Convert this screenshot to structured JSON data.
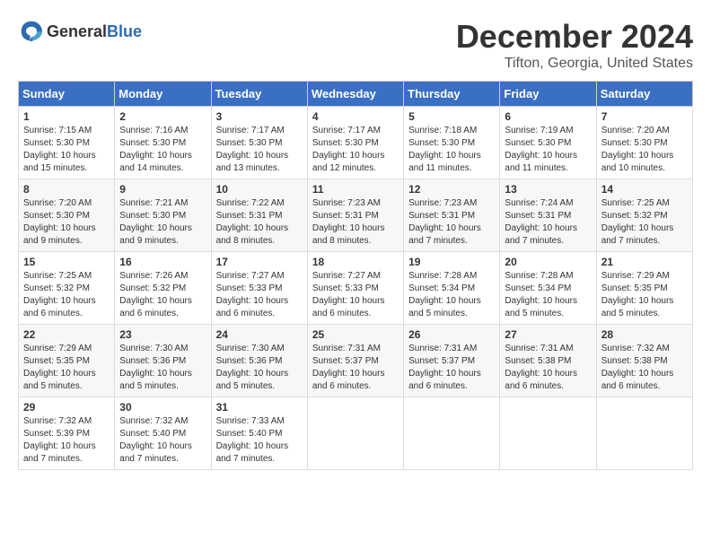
{
  "header": {
    "logo_general": "General",
    "logo_blue": "Blue",
    "month_year": "December 2024",
    "location": "Tifton, Georgia, United States"
  },
  "days_of_week": [
    "Sunday",
    "Monday",
    "Tuesday",
    "Wednesday",
    "Thursday",
    "Friday",
    "Saturday"
  ],
  "weeks": [
    [
      {
        "day": "1",
        "sunrise": "Sunrise: 7:15 AM",
        "sunset": "Sunset: 5:30 PM",
        "daylight": "Daylight: 10 hours and 15 minutes."
      },
      {
        "day": "2",
        "sunrise": "Sunrise: 7:16 AM",
        "sunset": "Sunset: 5:30 PM",
        "daylight": "Daylight: 10 hours and 14 minutes."
      },
      {
        "day": "3",
        "sunrise": "Sunrise: 7:17 AM",
        "sunset": "Sunset: 5:30 PM",
        "daylight": "Daylight: 10 hours and 13 minutes."
      },
      {
        "day": "4",
        "sunrise": "Sunrise: 7:17 AM",
        "sunset": "Sunset: 5:30 PM",
        "daylight": "Daylight: 10 hours and 12 minutes."
      },
      {
        "day": "5",
        "sunrise": "Sunrise: 7:18 AM",
        "sunset": "Sunset: 5:30 PM",
        "daylight": "Daylight: 10 hours and 11 minutes."
      },
      {
        "day": "6",
        "sunrise": "Sunrise: 7:19 AM",
        "sunset": "Sunset: 5:30 PM",
        "daylight": "Daylight: 10 hours and 11 minutes."
      },
      {
        "day": "7",
        "sunrise": "Sunrise: 7:20 AM",
        "sunset": "Sunset: 5:30 PM",
        "daylight": "Daylight: 10 hours and 10 minutes."
      }
    ],
    [
      {
        "day": "8",
        "sunrise": "Sunrise: 7:20 AM",
        "sunset": "Sunset: 5:30 PM",
        "daylight": "Daylight: 10 hours and 9 minutes."
      },
      {
        "day": "9",
        "sunrise": "Sunrise: 7:21 AM",
        "sunset": "Sunset: 5:30 PM",
        "daylight": "Daylight: 10 hours and 9 minutes."
      },
      {
        "day": "10",
        "sunrise": "Sunrise: 7:22 AM",
        "sunset": "Sunset: 5:31 PM",
        "daylight": "Daylight: 10 hours and 8 minutes."
      },
      {
        "day": "11",
        "sunrise": "Sunrise: 7:23 AM",
        "sunset": "Sunset: 5:31 PM",
        "daylight": "Daylight: 10 hours and 8 minutes."
      },
      {
        "day": "12",
        "sunrise": "Sunrise: 7:23 AM",
        "sunset": "Sunset: 5:31 PM",
        "daylight": "Daylight: 10 hours and 7 minutes."
      },
      {
        "day": "13",
        "sunrise": "Sunrise: 7:24 AM",
        "sunset": "Sunset: 5:31 PM",
        "daylight": "Daylight: 10 hours and 7 minutes."
      },
      {
        "day": "14",
        "sunrise": "Sunrise: 7:25 AM",
        "sunset": "Sunset: 5:32 PM",
        "daylight": "Daylight: 10 hours and 7 minutes."
      }
    ],
    [
      {
        "day": "15",
        "sunrise": "Sunrise: 7:25 AM",
        "sunset": "Sunset: 5:32 PM",
        "daylight": "Daylight: 10 hours and 6 minutes."
      },
      {
        "day": "16",
        "sunrise": "Sunrise: 7:26 AM",
        "sunset": "Sunset: 5:32 PM",
        "daylight": "Daylight: 10 hours and 6 minutes."
      },
      {
        "day": "17",
        "sunrise": "Sunrise: 7:27 AM",
        "sunset": "Sunset: 5:33 PM",
        "daylight": "Daylight: 10 hours and 6 minutes."
      },
      {
        "day": "18",
        "sunrise": "Sunrise: 7:27 AM",
        "sunset": "Sunset: 5:33 PM",
        "daylight": "Daylight: 10 hours and 6 minutes."
      },
      {
        "day": "19",
        "sunrise": "Sunrise: 7:28 AM",
        "sunset": "Sunset: 5:34 PM",
        "daylight": "Daylight: 10 hours and 5 minutes."
      },
      {
        "day": "20",
        "sunrise": "Sunrise: 7:28 AM",
        "sunset": "Sunset: 5:34 PM",
        "daylight": "Daylight: 10 hours and 5 minutes."
      },
      {
        "day": "21",
        "sunrise": "Sunrise: 7:29 AM",
        "sunset": "Sunset: 5:35 PM",
        "daylight": "Daylight: 10 hours and 5 minutes."
      }
    ],
    [
      {
        "day": "22",
        "sunrise": "Sunrise: 7:29 AM",
        "sunset": "Sunset: 5:35 PM",
        "daylight": "Daylight: 10 hours and 5 minutes."
      },
      {
        "day": "23",
        "sunrise": "Sunrise: 7:30 AM",
        "sunset": "Sunset: 5:36 PM",
        "daylight": "Daylight: 10 hours and 5 minutes."
      },
      {
        "day": "24",
        "sunrise": "Sunrise: 7:30 AM",
        "sunset": "Sunset: 5:36 PM",
        "daylight": "Daylight: 10 hours and 5 minutes."
      },
      {
        "day": "25",
        "sunrise": "Sunrise: 7:31 AM",
        "sunset": "Sunset: 5:37 PM",
        "daylight": "Daylight: 10 hours and 6 minutes."
      },
      {
        "day": "26",
        "sunrise": "Sunrise: 7:31 AM",
        "sunset": "Sunset: 5:37 PM",
        "daylight": "Daylight: 10 hours and 6 minutes."
      },
      {
        "day": "27",
        "sunrise": "Sunrise: 7:31 AM",
        "sunset": "Sunset: 5:38 PM",
        "daylight": "Daylight: 10 hours and 6 minutes."
      },
      {
        "day": "28",
        "sunrise": "Sunrise: 7:32 AM",
        "sunset": "Sunset: 5:38 PM",
        "daylight": "Daylight: 10 hours and 6 minutes."
      }
    ],
    [
      {
        "day": "29",
        "sunrise": "Sunrise: 7:32 AM",
        "sunset": "Sunset: 5:39 PM",
        "daylight": "Daylight: 10 hours and 7 minutes."
      },
      {
        "day": "30",
        "sunrise": "Sunrise: 7:32 AM",
        "sunset": "Sunset: 5:40 PM",
        "daylight": "Daylight: 10 hours and 7 minutes."
      },
      {
        "day": "31",
        "sunrise": "Sunrise: 7:33 AM",
        "sunset": "Sunset: 5:40 PM",
        "daylight": "Daylight: 10 hours and 7 minutes."
      },
      null,
      null,
      null,
      null
    ]
  ]
}
